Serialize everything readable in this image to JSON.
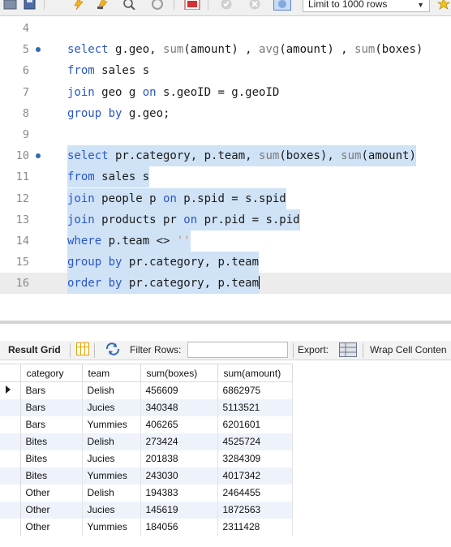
{
  "toolbar": {
    "limit_select": "Limit to 1000 rows",
    "buttons": [
      "open-folder",
      "save",
      "execute",
      "execute-current",
      "explain",
      "stop",
      "commit-toggle",
      "cancel",
      "rollback",
      "autocommit",
      "beautify"
    ]
  },
  "editor": {
    "lines": [
      {
        "num": "4",
        "code": ""
      },
      {
        "num": "5",
        "code": "select g.geo, sum(amount) , avg(amount) , sum(boxes)",
        "marker": true
      },
      {
        "num": "6",
        "code": "from sales s"
      },
      {
        "num": "7",
        "code": "join geo g on s.geoID = g.geoID"
      },
      {
        "num": "8",
        "code": "group by g.geo;"
      },
      {
        "num": "9",
        "code": ""
      },
      {
        "num": "10",
        "code": "select pr.category, p.team, sum(boxes), sum(amount)",
        "marker": true
      },
      {
        "num": "11",
        "code": "from sales s"
      },
      {
        "num": "12",
        "code": "join people p on p.spid = s.spid"
      },
      {
        "num": "13",
        "code": "join products pr on pr.pid = s.pid"
      },
      {
        "num": "14",
        "code": "where p.team <> ''"
      },
      {
        "num": "15",
        "code": "group by pr.category, p.team"
      },
      {
        "num": "16",
        "code": "order by pr.category, p.team"
      }
    ]
  },
  "result_toolbar": {
    "result_grid": "Result Grid",
    "filter_rows": "Filter Rows:",
    "filter_value": "",
    "export": "Export:",
    "wrap": "Wrap Cell Conten"
  },
  "grid": {
    "columns": [
      "category",
      "team",
      "sum(boxes)",
      "sum(amount)"
    ],
    "rows": [
      [
        "Bars",
        "Delish",
        "456609",
        "6862975"
      ],
      [
        "Bars",
        "Jucies",
        "340348",
        "5113521"
      ],
      [
        "Bars",
        "Yummies",
        "406265",
        "6201601"
      ],
      [
        "Bites",
        "Delish",
        "273424",
        "4525724"
      ],
      [
        "Bites",
        "Jucies",
        "201838",
        "3284309"
      ],
      [
        "Bites",
        "Yummies",
        "243030",
        "4017342"
      ],
      [
        "Other",
        "Delish",
        "194383",
        "2464455"
      ],
      [
        "Other",
        "Jucies",
        "145619",
        "1872563"
      ],
      [
        "Other",
        "Yummies",
        "184056",
        "2311428"
      ]
    ]
  },
  "colors": {
    "keyword": "#2b57c4",
    "function": "#7a7a7a",
    "selection": "#cfe2f6",
    "row_alt": "#eef3fb"
  }
}
